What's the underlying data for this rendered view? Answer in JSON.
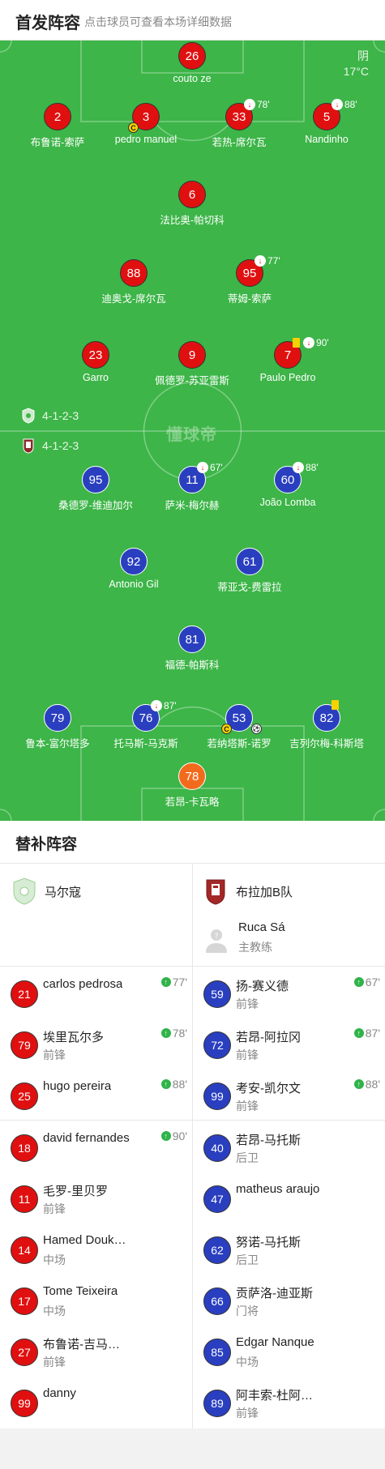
{
  "header": {
    "title": "首发阵容",
    "subtitle": "点击球员可查看本场详细数据"
  },
  "weather": {
    "condition": "阴",
    "temp": "17°C"
  },
  "watermark": "懂球帝",
  "formations": {
    "home": "4-1-2-3",
    "away": "4-1-2-3"
  },
  "home_players": [
    {
      "num": "26",
      "name": "couto ze",
      "color": "red"
    },
    {
      "num": "2",
      "name": "布鲁诺-索萨",
      "color": "red"
    },
    {
      "num": "3",
      "name": "pedro manuel",
      "color": "red",
      "captain": "C"
    },
    {
      "num": "33",
      "name": "若热-席尔瓦",
      "color": "red",
      "sub_time": "78'"
    },
    {
      "num": "5",
      "name": "Nandinho",
      "color": "red",
      "sub_time": "88'"
    },
    {
      "num": "6",
      "name": "法比奥-帕切科",
      "color": "red"
    },
    {
      "num": "88",
      "name": "迪奥戈-席尔瓦",
      "color": "red"
    },
    {
      "num": "95",
      "name": "蒂姆-索萨",
      "color": "red",
      "sub_time": "77'"
    },
    {
      "num": "23",
      "name": "Garro",
      "color": "red"
    },
    {
      "num": "9",
      "name": "佩德罗-苏亚雷斯",
      "color": "red"
    },
    {
      "num": "7",
      "name": "Paulo Pedro",
      "color": "red",
      "sub_time": "90'",
      "yellow": true
    }
  ],
  "away_players": [
    {
      "num": "95",
      "name": "桑德罗-维迪加尔",
      "color": "blue"
    },
    {
      "num": "11",
      "name": "萨米-梅尔赫",
      "color": "blue",
      "sub_time": "67'"
    },
    {
      "num": "60",
      "name": "João Lomba",
      "color": "blue",
      "sub_time": "88'"
    },
    {
      "num": "92",
      "name": "Antonio Gil",
      "color": "blue"
    },
    {
      "num": "61",
      "name": "蒂亚戈-费雷拉",
      "color": "blue"
    },
    {
      "num": "81",
      "name": "福德-帕斯科",
      "color": "blue"
    },
    {
      "num": "79",
      "name": "鲁本-富尔塔多",
      "color": "blue"
    },
    {
      "num": "76",
      "name": "托马斯-马克斯",
      "color": "blue",
      "sub_time": "87'"
    },
    {
      "num": "53",
      "name": "若纳塔斯-诺罗",
      "color": "blue",
      "captain": "C",
      "goal": true
    },
    {
      "num": "82",
      "name": "吉列尔梅-科斯塔",
      "color": "blue",
      "yellow": true
    },
    {
      "num": "78",
      "name": "若昂-卡瓦略",
      "color": "orange"
    }
  ],
  "subs": {
    "title": "替补阵容",
    "home_team": "马尔寇",
    "away_team": "布拉加B队",
    "coach_name": "Ruca Sá",
    "coach_role": "主教练",
    "home": [
      {
        "num": "21",
        "name": "carlos pedrosa",
        "pos": "",
        "in": "77'"
      },
      {
        "num": "79",
        "name": "埃里瓦尔多",
        "pos": "前锋",
        "in": "78'"
      },
      {
        "num": "25",
        "name": "hugo pereira",
        "pos": "",
        "in": "88'"
      },
      {
        "num": "18",
        "name": "david fernandes",
        "pos": "",
        "in": "90'"
      },
      {
        "num": "11",
        "name": "毛罗-里贝罗",
        "pos": "前锋",
        "in": ""
      },
      {
        "num": "14",
        "name": "Hamed Douk…",
        "pos": "中场",
        "in": ""
      },
      {
        "num": "17",
        "name": "Tome Teixeira",
        "pos": "中场",
        "in": ""
      },
      {
        "num": "27",
        "name": "布鲁诺-吉马…",
        "pos": "前锋",
        "in": ""
      },
      {
        "num": "99",
        "name": "danny",
        "pos": "",
        "in": ""
      }
    ],
    "away": [
      {
        "num": "59",
        "name": "扬-赛义德",
        "pos": "前锋",
        "in": "67'"
      },
      {
        "num": "72",
        "name": "若昂-阿拉冈",
        "pos": "前锋",
        "in": "87'"
      },
      {
        "num": "99",
        "name": "考安-凯尔文",
        "pos": "前锋",
        "in": "88'"
      },
      {
        "num": "40",
        "name": "若昂-马托斯",
        "pos": "后卫",
        "in": ""
      },
      {
        "num": "47",
        "name": "matheus araujo",
        "pos": "",
        "in": ""
      },
      {
        "num": "62",
        "name": "努诺-马托斯",
        "pos": "后卫",
        "in": ""
      },
      {
        "num": "66",
        "name": "贡萨洛-迪亚斯",
        "pos": "门将",
        "in": ""
      },
      {
        "num": "85",
        "name": "Edgar Nanque",
        "pos": "中场",
        "in": ""
      },
      {
        "num": "89",
        "name": "阿丰索-杜阿…",
        "pos": "前锋",
        "in": ""
      }
    ]
  }
}
